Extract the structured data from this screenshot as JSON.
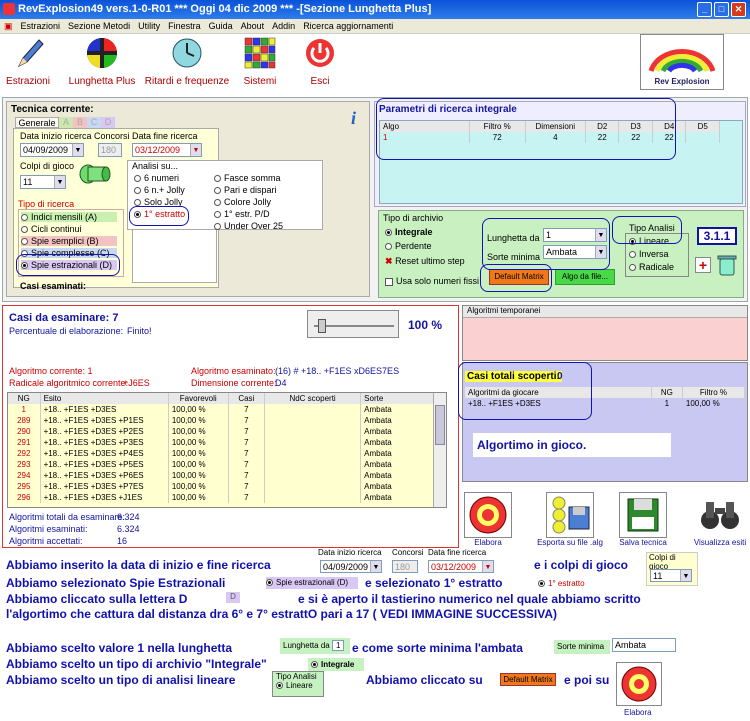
{
  "window": {
    "title": "RevExplosion49 vers.1-0-R01   ***  Oggi 04 dic 2009  ***   -[Sezione Lunghetta Plus]"
  },
  "menu": [
    "Estrazioni",
    "Sezione Metodi",
    "Utility",
    "Finestra",
    "Guida",
    "About",
    "Addin",
    "Ricerca aggiornamenti"
  ],
  "toolbar": [
    "Estrazioni",
    "Lunghetta Plus",
    "Ritardi e frequenze",
    "Sistemi",
    "Esci"
  ],
  "logo": {
    "text": "Rev Explosion"
  },
  "tecnica": {
    "title": "Tecnica corrente:",
    "tabs": [
      "Generale",
      "A",
      "B",
      "C",
      "D"
    ],
    "data_inizio_label": "Data inizio ricerca",
    "data_inizio": "04/09/2009",
    "concorsi_label": "Concorsi",
    "concorsi": "180",
    "data_fine_label": "Data fine ricerca",
    "data_fine": "03/12/2009",
    "colpi_label": "Colpi di gioco",
    "colpi": "11",
    "tipo_label": "Tipo di ricerca",
    "tipi": [
      "Indici mensili (A)",
      "Cicli continui",
      "Spie semplici (B)",
      "Spie complesse (C)",
      "Spie estrazionali (D)"
    ],
    "analisi_label": "Analisi su...",
    "analisi_left": [
      "6 numeri",
      "6 n.+ Jolly",
      "Solo Jolly",
      "1° estratto"
    ],
    "analisi_right": [
      "Fasce somma",
      "Pari e dispari",
      "Colore Jolly",
      "1° estr. P/D",
      "Under Over 25"
    ],
    "casi_esaminati": "Casi esaminati:"
  },
  "parametri": {
    "title": "Parametri di ricerca integrale",
    "headers": [
      "Algo",
      "Filtro %",
      "Dimensioni",
      "D2",
      "D3",
      "D4",
      "D5"
    ],
    "row": [
      "1",
      "72",
      "4",
      "22",
      "22",
      "22",
      ""
    ]
  },
  "archivio": {
    "title": "Tipo di archivio",
    "options": [
      "Integrale",
      "Perdente"
    ],
    "reset": "Reset ultimo step",
    "usa_solo": "Usa solo numeri fissi",
    "lunghetta_label": "Lunghetta da",
    "lunghetta": "1",
    "sorte_label": "Sorte minima",
    "sorte": "Ambata",
    "default_matrix": "Default Matrix",
    "algo_file": "Algo da file...",
    "tipo_analisi": "Tipo Analisi",
    "analisi": [
      "Lineare",
      "Inversa",
      "Radicale"
    ],
    "version": "3.1.1"
  },
  "casi": {
    "title": "Casi da esaminare: 7",
    "percent": "100 %",
    "perc_label": "Percentuale di elaborazione:",
    "perc_value": "Finito!",
    "algo_corrente": "Algoritmo corrente: 1",
    "radicale": "Radicale algoritmico corrente:",
    "radicale_val": "+J6ES",
    "algo_esaminato": "Algoritmo esaminato:",
    "algo_esaminato_val": "(16) # +18.. +F1ES xD6ES7ES",
    "dimensione": "Dimensione corrente:",
    "dimensione_val": "D4",
    "headers": [
      "NG",
      "Esito",
      "Favorevoli",
      "Casi",
      "NdC scoperti",
      "Sorte"
    ],
    "rows": [
      [
        "1",
        "+18.. +F1ES +D3ES",
        "100,00 %",
        "7",
        "",
        "Ambata"
      ],
      [
        "289",
        "+18.. +F1ES +D3ES +P1ES",
        "100,00 %",
        "7",
        "",
        "Ambata"
      ],
      [
        "290",
        "+18.. +F1ES +D3ES +P2ES",
        "100,00 %",
        "7",
        "",
        "Ambata"
      ],
      [
        "291",
        "+18.. +F1ES +D3ES +P3ES",
        "100,00 %",
        "7",
        "",
        "Ambata"
      ],
      [
        "292",
        "+18.. +F1ES +D3ES +P4ES",
        "100,00 %",
        "7",
        "",
        "Ambata"
      ],
      [
        "293",
        "+18.. +F1ES +D3ES +P5ES",
        "100,00 %",
        "7",
        "",
        "Ambata"
      ],
      [
        "294",
        "+18.. +F1ES +D3ES +P6ES",
        "100,00 %",
        "7",
        "",
        "Ambata"
      ],
      [
        "295",
        "+18.. +F1ES +D3ES +P7ES",
        "100,00 %",
        "7",
        "",
        "Ambata"
      ],
      [
        "296",
        "+18.. +F1ES +D3ES +J1ES",
        "100,00 %",
        "7",
        "",
        "Ambata"
      ]
    ],
    "stats": [
      [
        "Algoritmi totali da esaminare:",
        "6.324"
      ],
      [
        "Algoritmi esaminati:",
        "6.324"
      ],
      [
        "Algoritmi accettati:",
        "16"
      ]
    ]
  },
  "right": {
    "temporanei": "Algoritmi temporanei",
    "casi_totali": "Casi totali scoperti:",
    "casi_totali_val": "0",
    "giocare_headers": [
      "Algoritmi da giocare",
      "NG",
      "Filtro %"
    ],
    "giocare_row": [
      "+18.. +F1ES +D3ES",
      "1",
      "100,00 %"
    ],
    "in_gioco": "Algortimo in gioco.",
    "buttons": [
      "Elabora",
      "Esporta su file .alg",
      "Salva tecnica",
      "Visualizza esiti"
    ]
  },
  "notes": {
    "l1": "Abbiamo inserito la data di inizio e fine ricerca",
    "l1b": "e i colpi di gioco",
    "l2": "Abbiamo selezionato Spie Estrazionali",
    "l2b": "e selezionato 1° estratto",
    "l3": "Abbiamo cliccato sulla lettera D",
    "l3b": "e si è aperto il tastierino numerico nel quale abbiamo scritto",
    "l4": "l'algortimo che cattura dal distanza dra 6° e 7° estrattO pari a 17 ( VEDI IMMAGINE SUCCESSIVA)",
    "l5": "Abbiamo scelto valore 1 nella lunghetta",
    "l5b": "e come sorte minima l'ambata",
    "l6": "Abbiamo scelto un tipo di archivio \"Integrale\"",
    "l7": "Abbiamo scelto un tipo di analisi lineare",
    "l7b": "Abbiamo cliccato su",
    "l7c": "e poi su",
    "ins_d": "D",
    "ins_elabora": "Elabora"
  }
}
